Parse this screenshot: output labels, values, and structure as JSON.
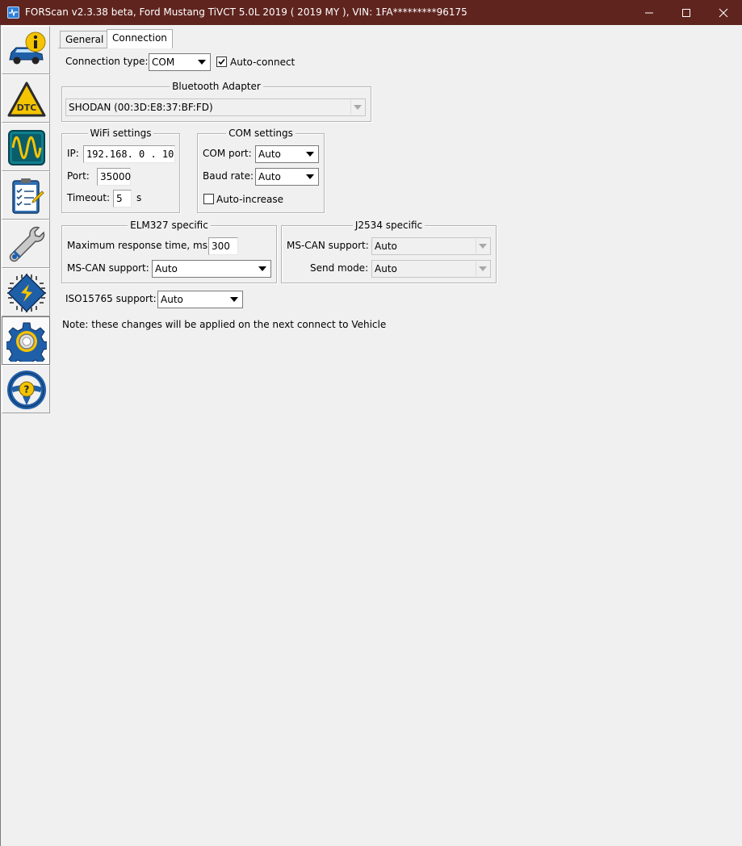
{
  "window": {
    "title": "FORScan v2.3.38 beta, Ford Mustang TiVCT 5.0L 2019 ( 2019 MY ), VIN: 1FA*********96175"
  },
  "sidebar": {
    "items": [
      {
        "name": "vehicle-info",
        "icon": "car-info-icon"
      },
      {
        "name": "dtc",
        "icon": "dtc-warning-icon",
        "label": "DTC"
      },
      {
        "name": "oscilloscope",
        "icon": "oscilloscope-icon"
      },
      {
        "name": "tests",
        "icon": "checklist-icon"
      },
      {
        "name": "service",
        "icon": "wrench-icon"
      },
      {
        "name": "configuration",
        "icon": "chip-icon"
      },
      {
        "name": "settings",
        "icon": "gear-icon",
        "active": true
      },
      {
        "name": "help",
        "icon": "steering-help-icon"
      }
    ]
  },
  "tabs": {
    "general": "General",
    "connection": "Connection"
  },
  "connection": {
    "type_label": "Connection type:",
    "type_value": "COM",
    "auto_connect_label": "Auto-connect",
    "auto_connect_checked": true
  },
  "bluetooth": {
    "title": "Bluetooth Adapter",
    "adapter": "SHODAN (00:3D:E8:37:BF:FD)"
  },
  "wifi": {
    "title": "WiFi settings",
    "ip_label": "IP:",
    "ip_value": "192.168. 0 . 10",
    "port_label": "Port:",
    "port_value": "35000",
    "timeout_label": "Timeout:",
    "timeout_value": "5",
    "timeout_unit": "s"
  },
  "com": {
    "title": "COM settings",
    "port_label": "COM port:",
    "port_value": "Auto",
    "baud_label": "Baud rate:",
    "baud_value": "Auto",
    "auto_increase_label": "Auto-increase",
    "auto_increase_checked": false
  },
  "elm327": {
    "title": "ELM327 specific",
    "max_resp_label": "Maximum response time, ms:",
    "max_resp_value": "300",
    "mscan_label": "MS-CAN support:",
    "mscan_value": "Auto"
  },
  "j2534": {
    "title": "J2534 specific",
    "mscan_label": "MS-CAN support:",
    "mscan_value": "Auto",
    "send_mode_label": "Send mode:",
    "send_mode_value": "Auto"
  },
  "iso15765": {
    "label": "ISO15765 support:",
    "value": "Auto"
  },
  "note": "Note: these changes will be applied on the next connect to Vehicle"
}
